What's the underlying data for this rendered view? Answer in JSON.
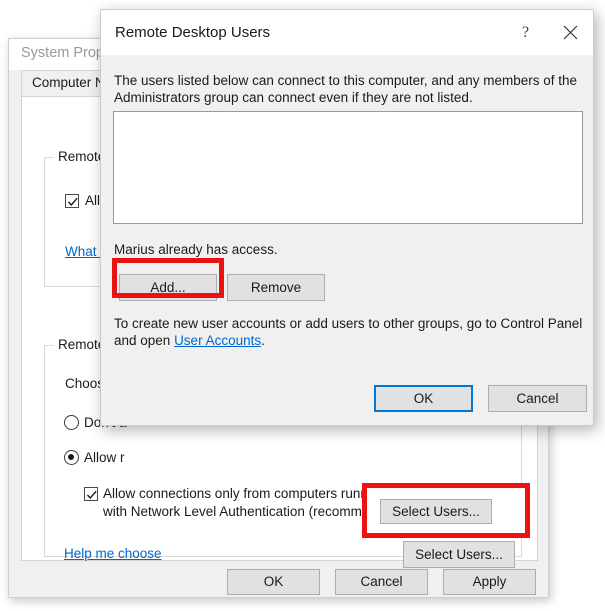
{
  "system_properties": {
    "title": "System Properties",
    "tab_label": "Computer Na",
    "remote_assistance": {
      "legend": "Remote A",
      "checkbox_label": "Allow R",
      "checkbox_checked": true,
      "link_label": "What hap"
    },
    "remote_desktop": {
      "legend": "Remote D",
      "choose_label": "Choose a",
      "option_dont_allow": "Don't a",
      "option_allow": "Allow r",
      "selected_option": "allow",
      "nla_checkbox_line1": "Allow connections only from computers running Remote Desktop",
      "nla_checkbox_line2": "with Network Level Authentication (recommended)",
      "nla_checked": true,
      "help_link": "Help me choose",
      "select_users_button": "Select Users..."
    },
    "footer": {
      "ok": "OK",
      "cancel": "Cancel",
      "apply": "Apply"
    }
  },
  "remote_desktop_users_dialog": {
    "title": "Remote Desktop Users",
    "help_glyph": "?",
    "close_glyph": "✕",
    "description_line1": "The users listed below can connect to this computer, and any members of the",
    "description_line2": "Administrators group can connect even if they are not listed.",
    "user_list": [],
    "access_text": "Marius already has access.",
    "add_button": "Add...",
    "remove_button": "Remove",
    "hint_prefix": "To create new user accounts or add users to other groups, go to Control Panel and open ",
    "hint_link": "User Accounts",
    "hint_suffix": ".",
    "ok_button": "OK",
    "cancel_button": "Cancel"
  },
  "annotations": {
    "accent_color": "#ee1111",
    "focus_color": "#0078d7",
    "link_color": "#0066cc",
    "highlight_add": "Add...",
    "highlight_select_users": "Select Users..."
  }
}
